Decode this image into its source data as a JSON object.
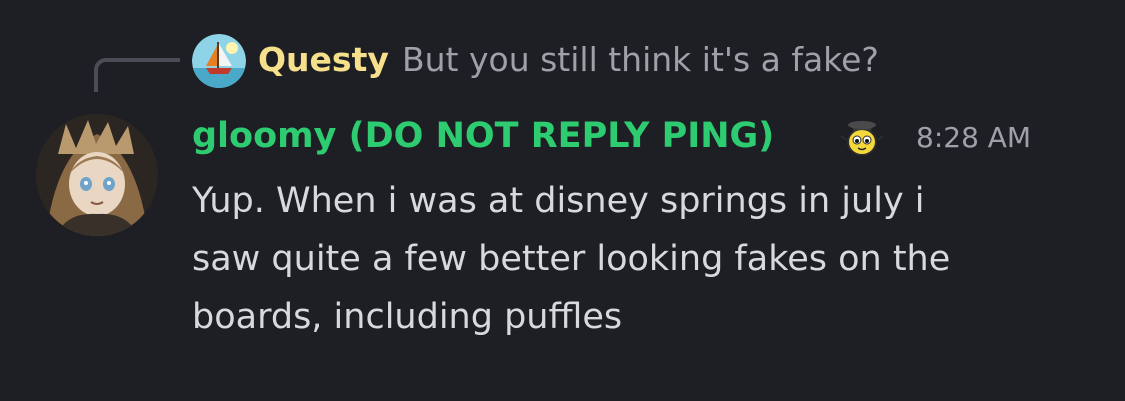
{
  "reply": {
    "author": "Questy",
    "text": "But you still think it's a fake?",
    "avatar_icon": "sailboat-avatar-icon"
  },
  "message": {
    "author": "gloomy (DO NOT REPLY PING)",
    "author_color": "#2ecc71",
    "role_icon": "yellow-puffle-icon",
    "timestamp": "8:28 AM",
    "lines": [
      "Yup. When i was at disney springs in july i",
      "saw quite a few better looking fakes on the",
      "boards, including puffles"
    ],
    "avatar_icon": "anime-girl-avatar-icon"
  },
  "colors": {
    "background": "#1e1f24",
    "reply_author": "#f7e08b",
    "muted_text": "#9ea1a8",
    "body_text": "#d8d9dc"
  }
}
